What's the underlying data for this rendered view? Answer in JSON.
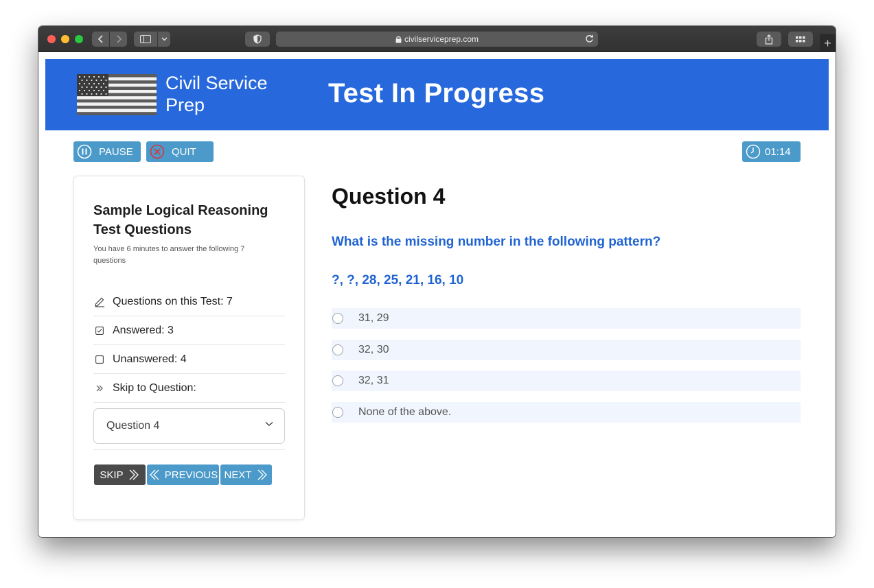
{
  "browser": {
    "url": "civilserviceprep.com"
  },
  "header": {
    "brand": "Civil Service Prep",
    "title": "Test In Progress",
    "color": "#2769dc"
  },
  "controls": {
    "pause_label": "PAUSE",
    "quit_label": "QUIT",
    "timer": "01:14",
    "accent": "#4b9ac9"
  },
  "panel": {
    "title": "Sample Logical Reasoning Test Questions",
    "subtitle": "You have 6 minutes to answer the following 7 questions",
    "stats": [
      {
        "icon": "pencil-icon",
        "label": "Questions on this Test: 7"
      },
      {
        "icon": "checkbox-checked-icon",
        "label": "Answered: 3"
      },
      {
        "icon": "checkbox-empty-icon",
        "label": "Unanswered: 4"
      },
      {
        "icon": "double-chevron-right-icon",
        "label": "Skip to Question:"
      }
    ],
    "select_value": "Question 4",
    "buttons": {
      "skip": "SKIP",
      "previous": "PREVIOUS",
      "next": "NEXT"
    }
  },
  "question": {
    "number_label": "Question 4",
    "text": "What is the missing number in the following pattern?",
    "sequence": "?, ?, 28, 25, 21, 16, 10",
    "options": [
      "31, 29",
      "32, 30",
      "32, 31",
      "None of the above."
    ]
  }
}
